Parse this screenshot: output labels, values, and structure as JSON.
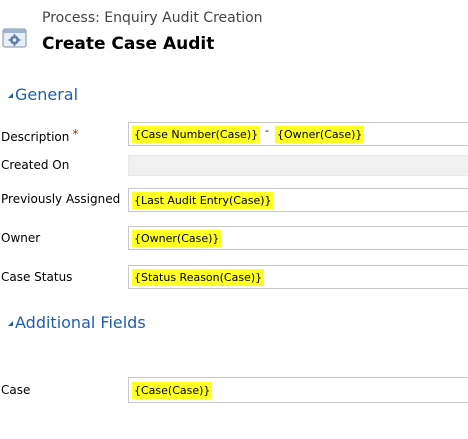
{
  "header": {
    "subtitle": "Process: Enquiry Audit Creation",
    "title": "Create Case Audit",
    "icon": "process-gear-icon"
  },
  "sections": {
    "general": "General",
    "additional": "Additional Fields"
  },
  "fields": {
    "description": {
      "label": "Description",
      "required_marker": "*",
      "token1": "{Case Number(Case)}",
      "separator": "-",
      "token2": "{Owner(Case)}"
    },
    "created_on": {
      "label": "Created On"
    },
    "previously_assigned": {
      "label": "Previously Assigned",
      "token": "{Last Audit Entry(Case)}"
    },
    "owner": {
      "label": "Owner",
      "token": "{Owner(Case)}"
    },
    "case_status": {
      "label": "Case Status",
      "token": "{Status Reason(Case)}"
    },
    "case": {
      "label": "Case",
      "token": "{Case(Case)}"
    }
  },
  "colors": {
    "section_title": "#1f5fa8",
    "token_highlight": "#ffff22",
    "required": "#e01010"
  }
}
